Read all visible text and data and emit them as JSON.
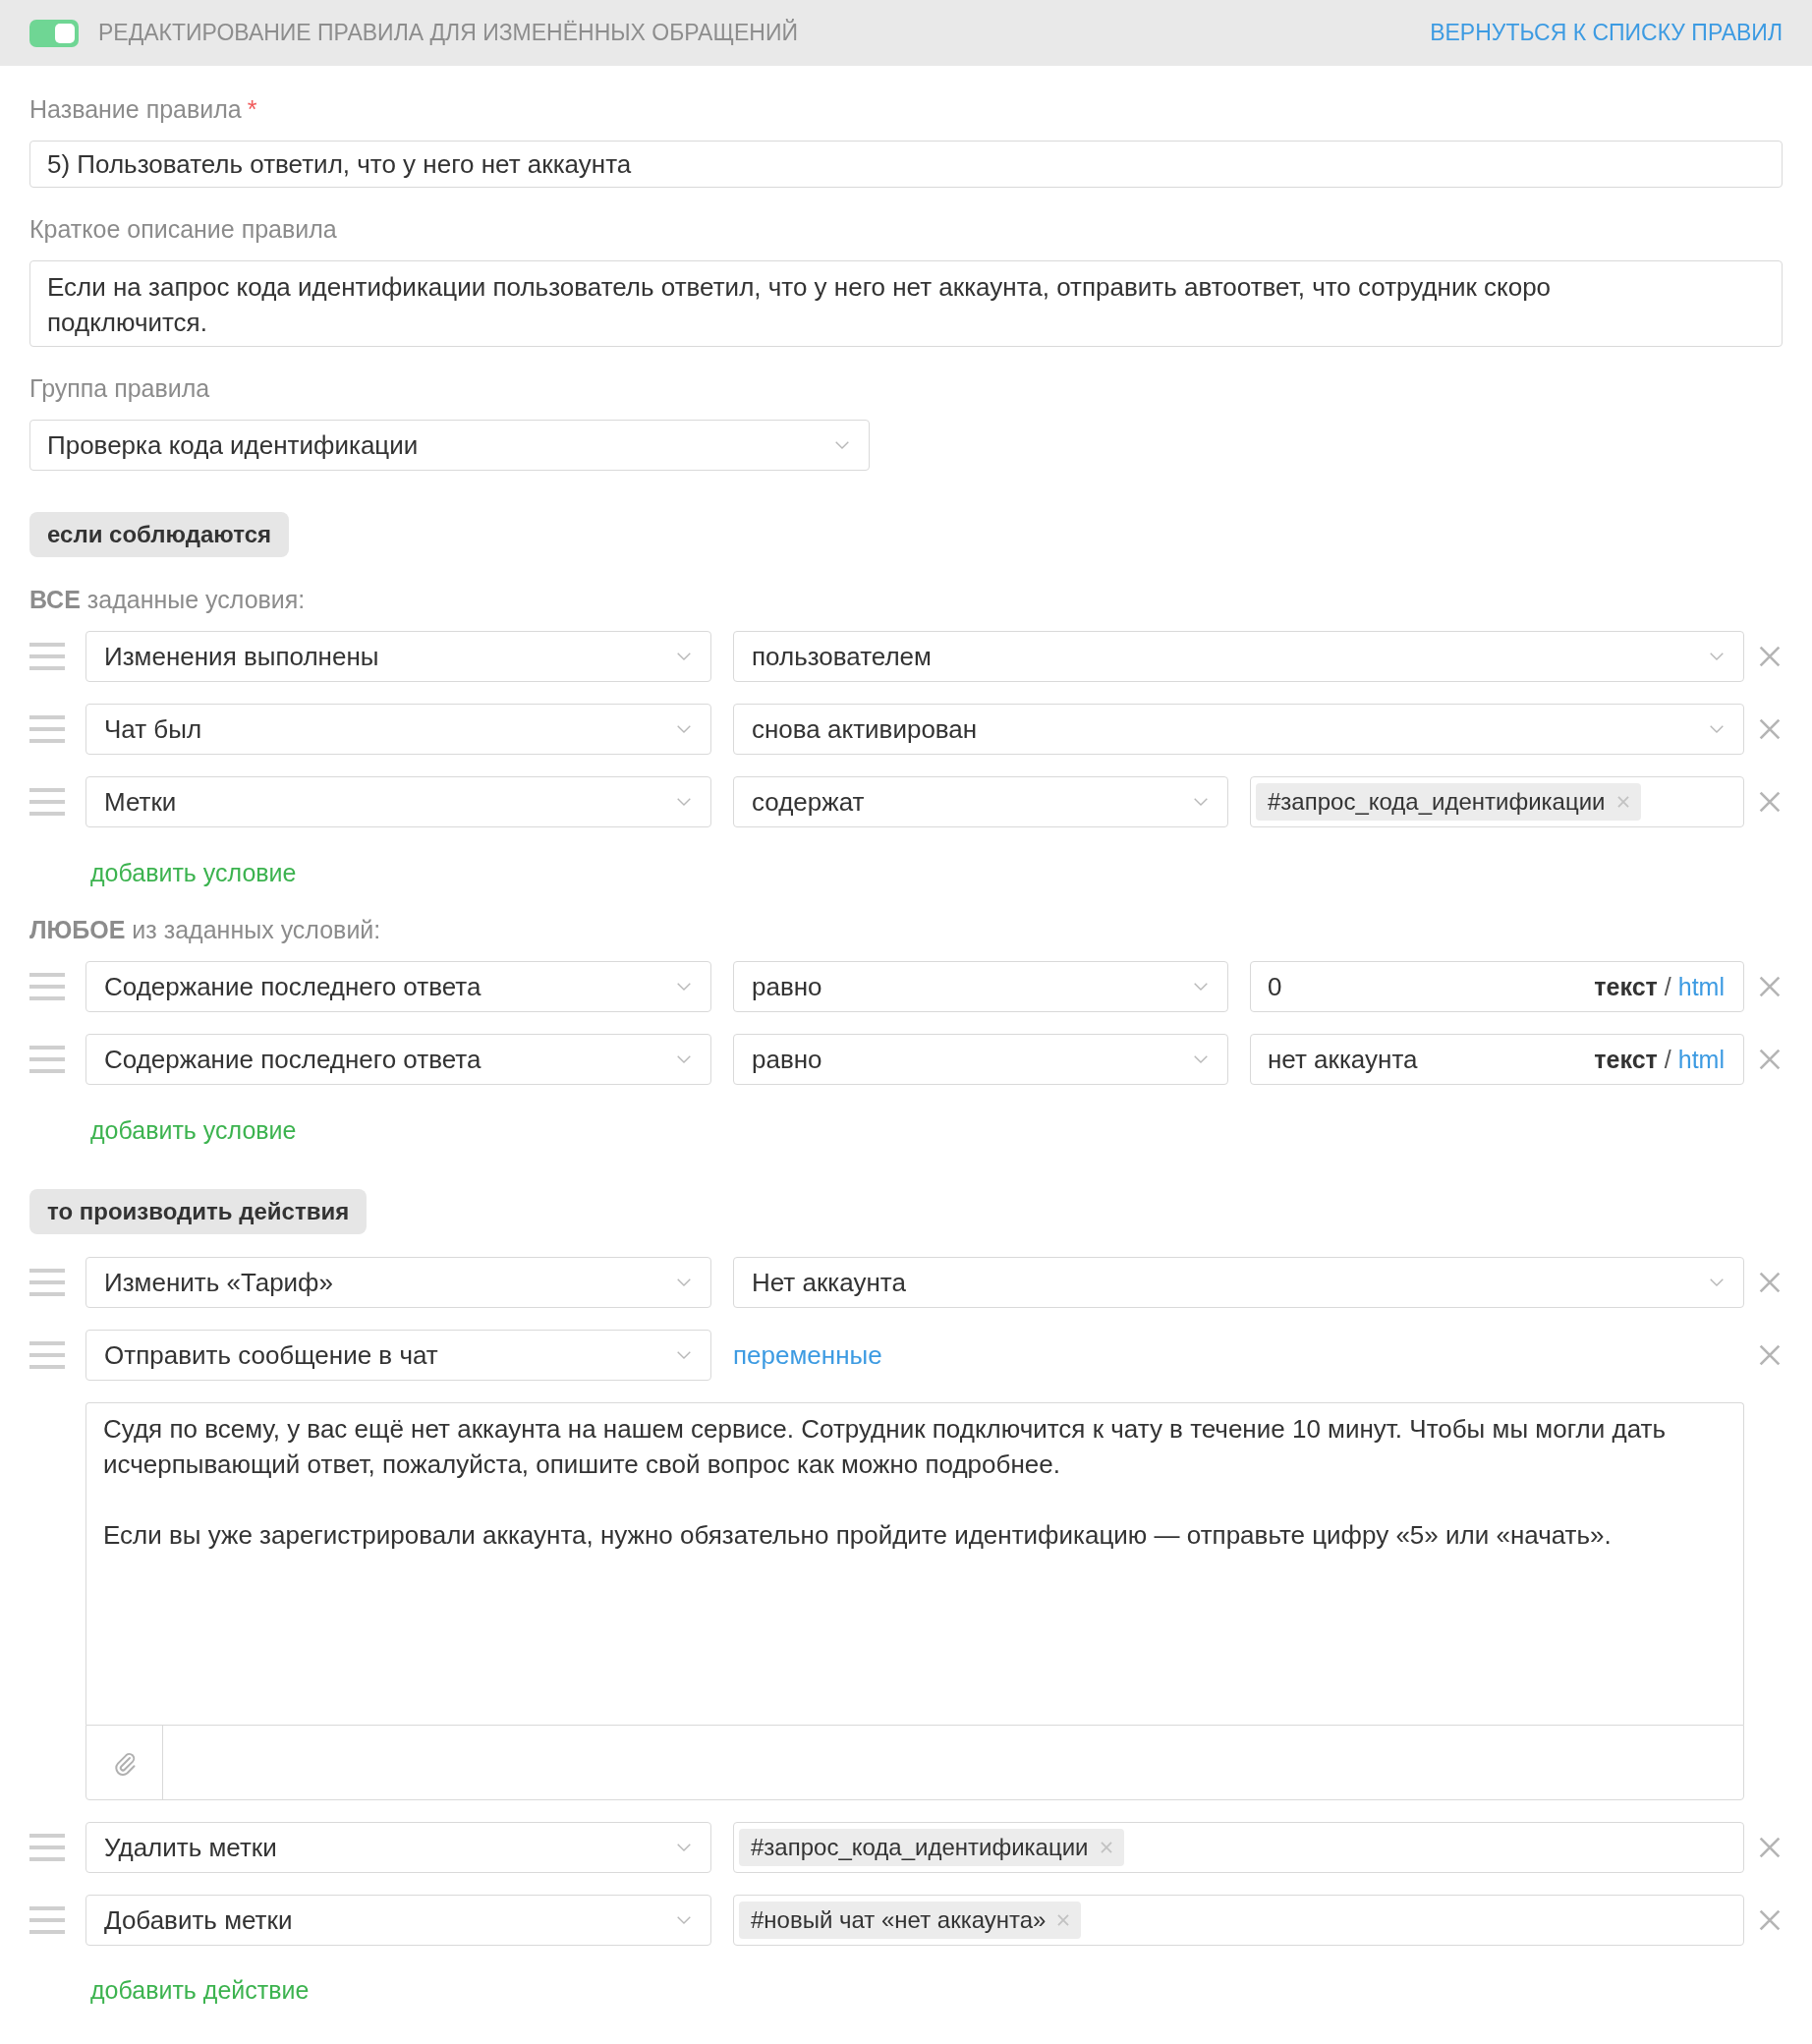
{
  "header": {
    "toggle": {
      "on": true
    },
    "title": "РЕДАКТИРОВАНИЕ ПРАВИЛА ДЛЯ ИЗМЕНЁННЫХ ОБРАЩЕНИЙ",
    "back_link": "ВЕРНУТЬСЯ К СПИСКУ ПРАВИЛ"
  },
  "fields": [
    {
      "kind": "input",
      "label": "Название правила",
      "required_mark": "*",
      "value": "5) Пользователь ответил, что у него нет аккаунта"
    },
    {
      "kind": "textarea",
      "label": "Краткое описание правила",
      "value": "Если на запрос кода идентификации пользователь ответил, что у него нет аккаунта, отправить автоответ, что сотрудник скоро подключится."
    },
    {
      "kind": "select",
      "label": "Группа правила",
      "value": "Проверка кода идентификации"
    }
  ],
  "conditions": {
    "heading": "если соблюдаются",
    "groups": [
      {
        "title": "**ВСЕ** заданные условия:",
        "rows": [
          {
            "cells": [
              {
                "kind": "select",
                "value": "Изменения выполнены"
              },
              {
                "kind": "select",
                "value": "пользователем"
              }
            ]
          },
          {
            "cells": [
              {
                "kind": "select",
                "value": "Чат был"
              },
              {
                "kind": "select",
                "value": "снова активирован"
              }
            ]
          },
          {
            "cells": [
              {
                "kind": "select",
                "value": "Метки"
              },
              {
                "kind": "select",
                "value": "содержат"
              },
              {
                "kind": "tags",
                "tags": [
                  "#запрос_кода_идентификации"
                ]
              }
            ]
          }
        ],
        "add_link": "добавить условие"
      },
      {
        "title": "**ЛЮБОЕ** из заданных условий:",
        "rows": [
          {
            "cells": [
              {
                "kind": "select",
                "value": "Содержание последнего ответа"
              },
              {
                "kind": "select",
                "value": "равно"
              },
              {
                "kind": "text",
                "value": "0",
                "formats": [
                  {
                    "label": "текст",
                    "selected": true
                  },
                  {
                    "label": "html",
                    "selected": false
                  }
                ],
                "separator": "/"
              }
            ]
          },
          {
            "cells": [
              {
                "kind": "select",
                "value": "Содержание последнего ответа"
              },
              {
                "kind": "select",
                "value": "равно"
              },
              {
                "kind": "text",
                "value": "нет аккаунта",
                "formats": [
                  {
                    "label": "текст",
                    "selected": true
                  },
                  {
                    "label": "html",
                    "selected": false
                  }
                ],
                "separator": "/"
              }
            ]
          }
        ],
        "add_link": "добавить условие"
      }
    ]
  },
  "actions": {
    "heading": "то производить действия",
    "rows": [
      {
        "cells": [
          {
            "kind": "select",
            "value": "Изменить «Тариф»"
          },
          {
            "kind": "select",
            "value": "Нет аккаунта"
          }
        ]
      },
      {
        "cells": [
          {
            "kind": "select",
            "value": "Отправить сообщение в чат"
          },
          {
            "kind": "link",
            "label": "переменные"
          }
        ],
        "message": {
          "text": "Судя по всему, у вас ещё нет аккаунта на нашем сервисе. Сотрудник подключится к чату в течение 10 минут. Чтобы мы могли дать исчерпывающий ответ, пожалуйста, опишите свой вопрос как можно подробнее.\n\nЕсли вы уже зарегистрировали аккаунта, нужно обязательно пройдите идентификацию — отправьте цифру «5» или «начать»."
        }
      },
      {
        "cells": [
          {
            "kind": "select",
            "value": "Удалить метки"
          },
          {
            "kind": "tags",
            "tags": [
              "#запрос_кода_идентификации"
            ]
          }
        ]
      },
      {
        "cells": [
          {
            "kind": "select",
            "value": "Добавить метки"
          },
          {
            "kind": "tags",
            "tags": [
              "#новый чат «нет аккаунта»"
            ]
          }
        ]
      }
    ],
    "add_link": "добавить действие"
  }
}
